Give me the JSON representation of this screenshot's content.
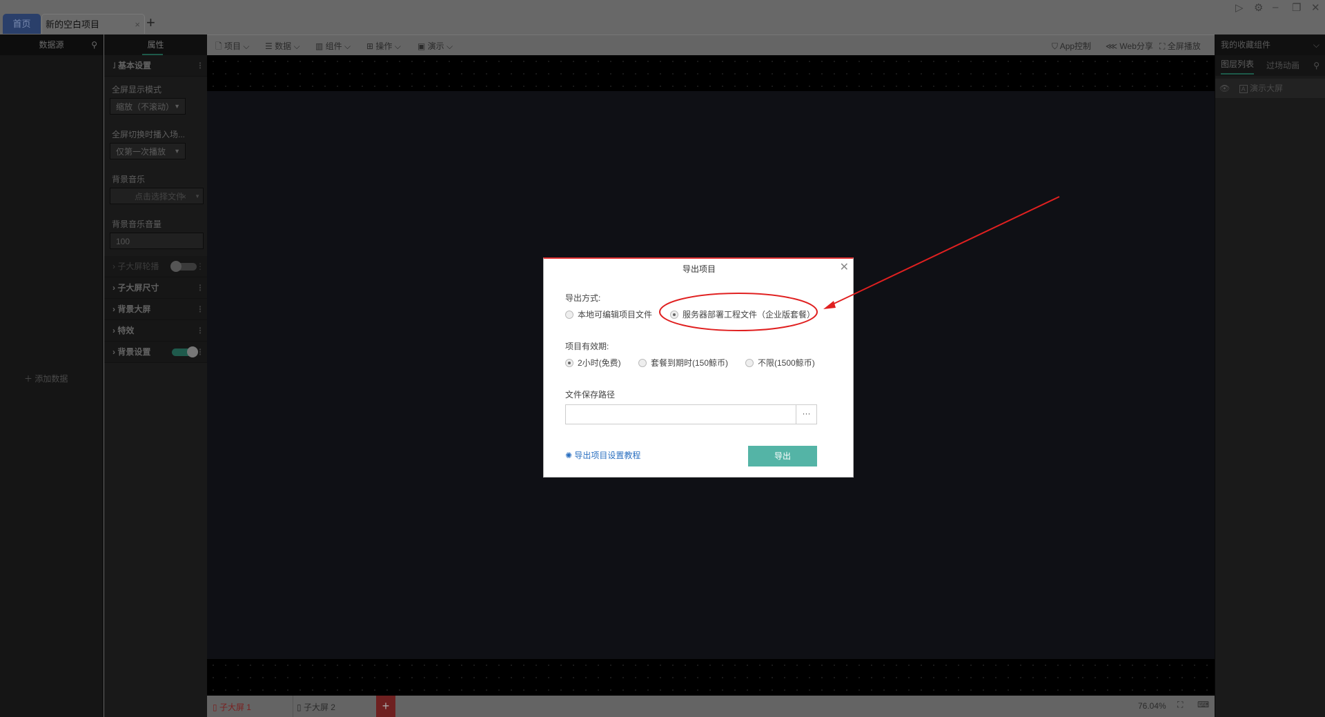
{
  "tabs": {
    "home": "首页",
    "project": "新的空白项目",
    "close": "×",
    "add": "+"
  },
  "window": {
    "play": "▷",
    "settings": "⚙",
    "minimize": "–",
    "restore": "❐",
    "close": "✕"
  },
  "left_panel": {
    "title": "数据源",
    "search_icon": "search-icon",
    "add_data": "添加数据"
  },
  "props": {
    "tab": "属性",
    "section_basic": "基本设置",
    "fullscreen_mode_label": "全屏显示模式",
    "fullscreen_mode_value": "缩放（不滚动）",
    "transition_label": "全屏切换时播入场...",
    "transition_value": "仅第一次播放",
    "bgm_label": "背景音乐",
    "bgm_placeholder": "点击选择文件",
    "bgm_volume_label": "背景音乐音量",
    "bgm_volume_value": "100",
    "sections": [
      {
        "label": "子大屏轮播",
        "toggle": false
      },
      {
        "label": "子大屏尺寸"
      },
      {
        "label": "背景大屏"
      },
      {
        "label": "特效"
      },
      {
        "label": "背景设置",
        "toggle": true
      }
    ]
  },
  "toolbar": {
    "items": [
      "项目",
      "数据",
      "组件",
      "操作",
      "演示"
    ],
    "app_control": "App控制",
    "web_share": "Web分享",
    "fullscreen": "全屏播放"
  },
  "right_panel": {
    "favorites": "我的收藏组件",
    "tab_layers": "图层列表",
    "tab_transition": "过场动画",
    "layer": "演示大屏"
  },
  "bottom": {
    "screens": [
      "子大屏 1",
      "子大屏 2"
    ],
    "add": "+",
    "zoom": "76.04%"
  },
  "dialog": {
    "title": "导出项目",
    "export_method_label": "导出方式:",
    "export_methods": [
      {
        "label": "本地可编辑项目文件",
        "selected": false
      },
      {
        "label": "服务器部署工程文件（企业版套餐）",
        "selected": true
      }
    ],
    "validity_label": "项目有效期:",
    "validity_options": [
      {
        "label": "2小时(免费)",
        "selected": true
      },
      {
        "label": "套餐到期时(150鲸币)",
        "selected": false
      },
      {
        "label": "不限(1500鲸币)",
        "selected": false
      }
    ],
    "path_label": "文件保存路径",
    "path_value": "",
    "browse": "···",
    "tutorial_link": "导出项目设置教程",
    "export_button": "导出"
  },
  "colors": {
    "accent": "#54b4a6",
    "annotation": "#e02020",
    "link": "#2a6fc0"
  }
}
